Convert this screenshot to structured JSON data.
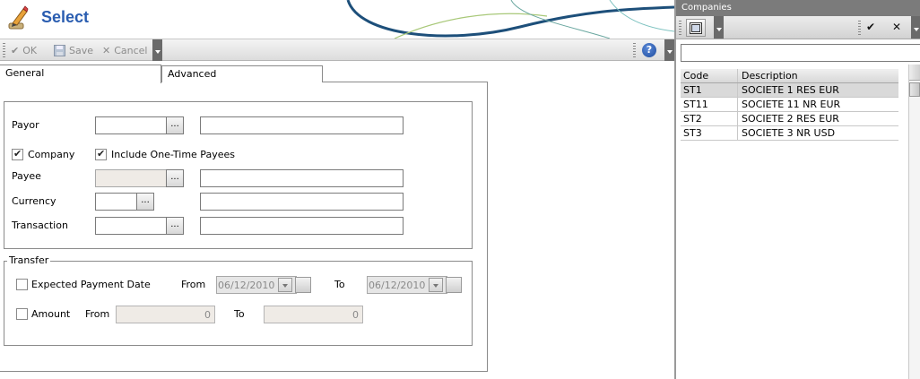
{
  "header": {
    "title": "Select",
    "icon": "pencil-edit-icon",
    "accent": "#2a5db0"
  },
  "toolbar": {
    "ok_label": "OK",
    "save_label": "Save",
    "cancel_label": "Cancel",
    "help_label": "?"
  },
  "tabs": [
    {
      "label": "General",
      "active": true
    },
    {
      "label": "Advanced",
      "active": false
    }
  ],
  "general": {
    "payor": {
      "label": "Payor",
      "code": "",
      "description": "",
      "lookup": "..."
    },
    "company": {
      "label": "Company",
      "checked": true
    },
    "include_one_time": {
      "label": "Include One-Time Payees",
      "checked": true
    },
    "payee": {
      "label": "Payee",
      "code": "",
      "description": "",
      "lookup": "..."
    },
    "currency": {
      "label": "Currency",
      "code": "",
      "description": "",
      "lookup": "..."
    },
    "transaction": {
      "label": "Transaction",
      "code": "",
      "description": "",
      "lookup": "..."
    }
  },
  "transfer": {
    "legend": "Transfer",
    "expected_payment_date": {
      "label": "Expected Payment Date",
      "checked": false,
      "from_label": "From",
      "from_value": "06/12/2010",
      "to_label": "To",
      "to_value": "06/12/2010"
    },
    "amount": {
      "label": "Amount",
      "checked": false,
      "from_label": "From",
      "from_value": "0",
      "to_label": "To",
      "to_value": "0"
    }
  },
  "companies": {
    "title": "Companies",
    "search_value": "",
    "columns": [
      "Code",
      "Description"
    ],
    "rows": [
      {
        "code": "ST1",
        "description": "SOCIETE 1 RES EUR",
        "selected": true
      },
      {
        "code": "ST11",
        "description": "SOCIETE 11 NR EUR",
        "selected": false
      },
      {
        "code": "ST2",
        "description": "SOCIETE 2 RES EUR",
        "selected": false
      },
      {
        "code": "ST3",
        "description": "SOCIETE 3 NR USD",
        "selected": false
      }
    ]
  }
}
